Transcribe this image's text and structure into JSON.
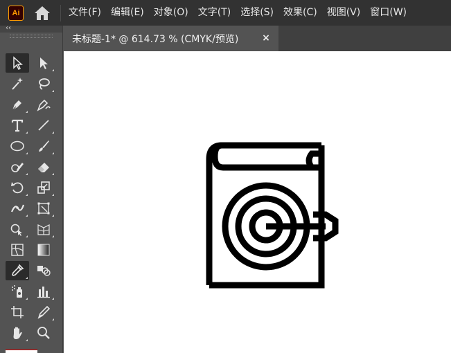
{
  "app": {
    "logo_text": "Ai",
    "accent": "#ff9a00"
  },
  "menu": {
    "items": [
      {
        "label": "文件(F)"
      },
      {
        "label": "编辑(E)"
      },
      {
        "label": "对象(O)"
      },
      {
        "label": "文字(T)"
      },
      {
        "label": "选择(S)"
      },
      {
        "label": "效果(C)"
      },
      {
        "label": "视图(V)"
      },
      {
        "label": "窗口(W)"
      }
    ]
  },
  "tools_panel": {
    "collapse_glyph": "‹‹",
    "tools": [
      {
        "name": "selection-tool",
        "icon": "arrow-icon",
        "active": true
      },
      {
        "name": "direct-selection-tool",
        "icon": "direct-arrow-icon"
      },
      {
        "name": "magic-wand-tool",
        "icon": "magic-wand-icon"
      },
      {
        "name": "lasso-tool",
        "icon": "lasso-icon"
      },
      {
        "name": "pen-tool",
        "icon": "pen-icon"
      },
      {
        "name": "curvature-tool",
        "icon": "curvature-pen-icon"
      },
      {
        "name": "type-tool",
        "icon": "type-icon"
      },
      {
        "name": "line-tool",
        "icon": "line-icon"
      },
      {
        "name": "ellipse-tool",
        "icon": "ellipse-icon"
      },
      {
        "name": "paintbrush-tool",
        "icon": "brush-icon"
      },
      {
        "name": "shaper-tool",
        "icon": "shaper-icon"
      },
      {
        "name": "eraser-tool",
        "icon": "eraser-icon"
      },
      {
        "name": "rotate-tool",
        "icon": "rotate-icon"
      },
      {
        "name": "scale-tool",
        "icon": "scale-icon"
      },
      {
        "name": "width-tool",
        "icon": "width-icon"
      },
      {
        "name": "free-transform-tool",
        "icon": "free-transform-icon"
      },
      {
        "name": "shape-builder-tool",
        "icon": "shape-builder-icon"
      },
      {
        "name": "perspective-grid-tool",
        "icon": "perspective-icon"
      },
      {
        "name": "mesh-tool",
        "icon": "mesh-icon"
      },
      {
        "name": "gradient-tool",
        "icon": "gradient-icon"
      },
      {
        "name": "eyedropper-tool",
        "icon": "eyedropper-icon",
        "active": true
      },
      {
        "name": "blend-tool",
        "icon": "blend-icon"
      },
      {
        "name": "symbol-sprayer-tool",
        "icon": "symbol-sprayer-icon"
      },
      {
        "name": "column-graph-tool",
        "icon": "bar-graph-icon"
      },
      {
        "name": "artboard-tool",
        "icon": "artboard-icon"
      },
      {
        "name": "slice-tool",
        "icon": "slice-icon"
      },
      {
        "name": "hand-tool",
        "icon": "hand-icon"
      },
      {
        "name": "zoom-tool",
        "icon": "zoom-icon"
      }
    ]
  },
  "document": {
    "tab_title": "未标题-1* @ 614.73 % (CMYK/预览)",
    "close_glyph": "×"
  },
  "colors": {
    "menubar_bg": "#323232",
    "panel_bg": "#535353",
    "tabbar_bg": "#404040",
    "canvas_bg": "#ffffff",
    "artwork_stroke": "#000000"
  }
}
